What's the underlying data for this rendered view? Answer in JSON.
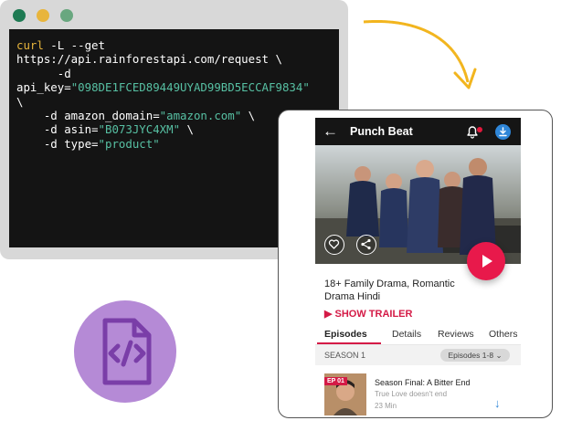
{
  "terminal": {
    "window_dots": [
      "#1e7a53",
      "#e8b53c",
      "#69a77f"
    ],
    "code": {
      "cmd": "curl",
      "flags": " -L --get",
      "url": "https://api.rainforestapi.com/request \\",
      "d1": "-d",
      "api_key_label": "api_key=",
      "api_key_value": "\"098DE1FCED89449UYAD99BD5ECCAF9834\"",
      "backslash": "\\",
      "d_domain": "-d amazon_domain=",
      "domain_value": "\"amazon.com\"",
      "d_asin": "-d asin=",
      "asin_value": "\"B073JYC4XM\"",
      "d_type": "-d type=",
      "type_value": "\"product\""
    }
  },
  "arrow": {
    "color": "#f2b51e"
  },
  "badge": {
    "icon": "code-file-icon",
    "color": "#b58ad6",
    "icon_color": "#7a3ea8"
  },
  "app": {
    "title": "Punch Beat",
    "back_icon": "arrow-left-icon",
    "genre": "18+ Family Drama, Romantic Drama Hindi",
    "trailer": "SHOW TRAILER",
    "tabs": [
      "Episodes",
      "Details",
      "Reviews",
      "Others"
    ],
    "season": "SEASON 1",
    "episodes_filter": "Episodes 1-8",
    "episode": {
      "tag": "EP 01",
      "title": "Season Final: A Bitter End",
      "subtitle": "True Love doesn't end",
      "duration": "23 Min"
    },
    "accent": "#d41a46",
    "download_color": "#2f86d8"
  }
}
